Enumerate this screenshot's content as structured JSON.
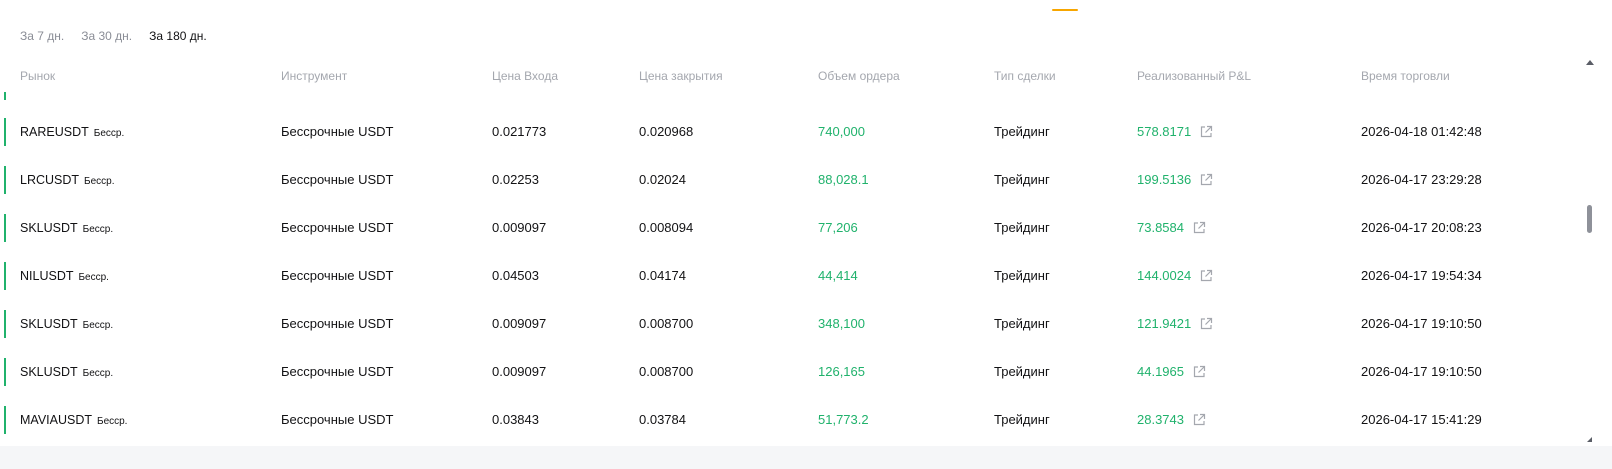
{
  "tabs": [
    {
      "label": "За 7 дн.",
      "active": false
    },
    {
      "label": "За 30 дн.",
      "active": false
    },
    {
      "label": "За 180 дн.",
      "active": true
    }
  ],
  "columns": [
    "Рынок",
    "Инструмент",
    "Цена Входа",
    "Цена закрытия",
    "Объем ордера",
    "Тип сделки",
    "Реализованный P&L",
    "Время торговли"
  ],
  "rows": [
    {
      "symbol": "RAREUSDT",
      "badge": "Бесср.",
      "instrument": "Бессрочные USDT",
      "entry": "0.021773",
      "close": "0.020968",
      "volume": "740,000",
      "type": "Трейдинг",
      "pnl": "578.8171",
      "time": "2026-04-18 01:42:48"
    },
    {
      "symbol": "LRCUSDT",
      "badge": "Бесср.",
      "instrument": "Бессрочные USDT",
      "entry": "0.02253",
      "close": "0.02024",
      "volume": "88,028.1",
      "type": "Трейдинг",
      "pnl": "199.5136",
      "time": "2026-04-17 23:29:28"
    },
    {
      "symbol": "SKLUSDT",
      "badge": "Бесср.",
      "instrument": "Бессрочные USDT",
      "entry": "0.009097",
      "close": "0.008094",
      "volume": "77,206",
      "type": "Трейдинг",
      "pnl": "73.8584",
      "time": "2026-04-17 20:08:23"
    },
    {
      "symbol": "NILUSDT",
      "badge": "Бесср.",
      "instrument": "Бессрочные USDT",
      "entry": "0.04503",
      "close": "0.04174",
      "volume": "44,414",
      "type": "Трейдинг",
      "pnl": "144.0024",
      "time": "2026-04-17 19:54:34"
    },
    {
      "symbol": "SKLUSDT",
      "badge": "Бесср.",
      "instrument": "Бессрочные USDT",
      "entry": "0.009097",
      "close": "0.008700",
      "volume": "348,100",
      "type": "Трейдинг",
      "pnl": "121.9421",
      "time": "2026-04-17 19:10:50"
    },
    {
      "symbol": "SKLUSDT",
      "badge": "Бесср.",
      "instrument": "Бессрочные USDT",
      "entry": "0.009097",
      "close": "0.008700",
      "volume": "126,165",
      "type": "Трейдинг",
      "pnl": "44.1965",
      "time": "2026-04-17 19:10:50"
    },
    {
      "symbol": "MAVIAUSDT",
      "badge": "Бесср.",
      "instrument": "Бессрочные USDT",
      "entry": "0.03843",
      "close": "0.03784",
      "volume": "51,773.2",
      "type": "Трейдинг",
      "pnl": "28.3743",
      "time": "2026-04-17 15:41:29"
    }
  ],
  "icons": {
    "pnl_link": "external-link-icon",
    "scroll_up": "scroll-up-arrow-icon"
  },
  "colors": {
    "accent": "#f7a600",
    "positive": "#20b26c",
    "muted": "#a4a7ae",
    "text": "#121214"
  }
}
